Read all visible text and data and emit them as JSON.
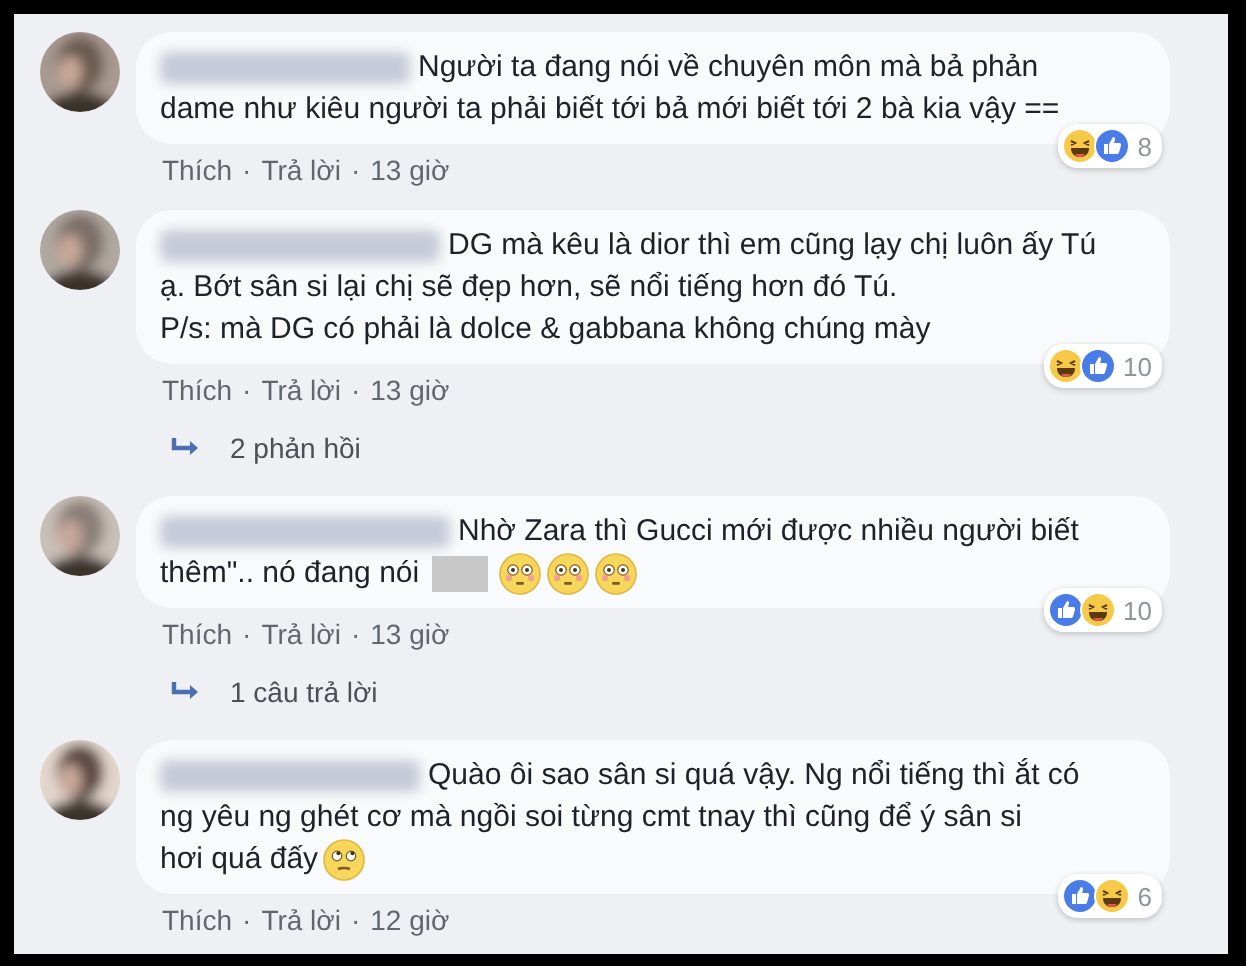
{
  "comments": [
    {
      "lines": [
        [
          {
            "kind": "text",
            "text": "Người ta đang nói về chuyên môn mà bả phản"
          }
        ],
        [
          {
            "kind": "text",
            "text": "dame như kiêu người ta phải biết tới bả mới biết tới 2 bà kia vậy =="
          }
        ]
      ],
      "reactions": [
        {
          "kind": "haha"
        },
        {
          "kind": "like"
        }
      ],
      "reaction_count": "8",
      "actions": [
        "Thích",
        "·",
        "Trả lời",
        "·",
        "13 giờ"
      ]
    },
    {
      "lines": [
        [
          {
            "kind": "text",
            "text": "DG mà kêu là dior thì em cũng lạy chị luôn ấy Tú"
          }
        ],
        [
          {
            "kind": "text",
            "text": "ạ. Bớt sân si lại chị sẽ đẹp hơn, sẽ nổi tiếng hơn đó Tú."
          }
        ],
        [
          {
            "kind": "text",
            "text": "P/s: mà DG có phải là dolce & gabbana không chúng mày"
          }
        ]
      ],
      "reactions": [
        {
          "kind": "haha"
        },
        {
          "kind": "like"
        }
      ],
      "reaction_count": "10",
      "actions": [
        "Thích",
        "·",
        "Trả lời",
        "·",
        "13 giờ"
      ],
      "replies": "2 phản hồi"
    },
    {
      "lines": [
        [
          {
            "kind": "text",
            "text": "Nhờ Zara thì Gucci mới được nhiều người biết"
          }
        ],
        [
          {
            "kind": "text",
            "text": "thêm\".. nó đang nói"
          },
          {
            "kind": "censored"
          },
          {
            "kind": "flushed"
          },
          {
            "kind": "flushed"
          },
          {
            "kind": "flushed"
          }
        ]
      ],
      "reactions": [
        {
          "kind": "like"
        },
        {
          "kind": "haha"
        }
      ],
      "reaction_count": "10",
      "actions": [
        "Thích",
        "·",
        "Trả lời",
        "·",
        "13 giờ"
      ],
      "replies": "1 câu trả lời"
    },
    {
      "lines": [
        [
          {
            "kind": "text",
            "text": "Quào ôi sao sân si quá vậy. Ng nổi tiếng thì ắt có"
          }
        ],
        [
          {
            "kind": "text",
            "text": "ng yêu ng ghét cơ mà ngồi soi từng cmt tnay thì cũng để ý sân si"
          }
        ],
        [
          {
            "kind": "text",
            "text": "hơi quá đấy"
          },
          {
            "kind": "rolling-eyes"
          }
        ]
      ],
      "reactions": [
        {
          "kind": "like"
        },
        {
          "kind": "haha"
        }
      ],
      "reaction_count": "6",
      "actions": [
        "Thích",
        "·",
        "Trả lời",
        "·",
        "12 giờ"
      ]
    }
  ]
}
